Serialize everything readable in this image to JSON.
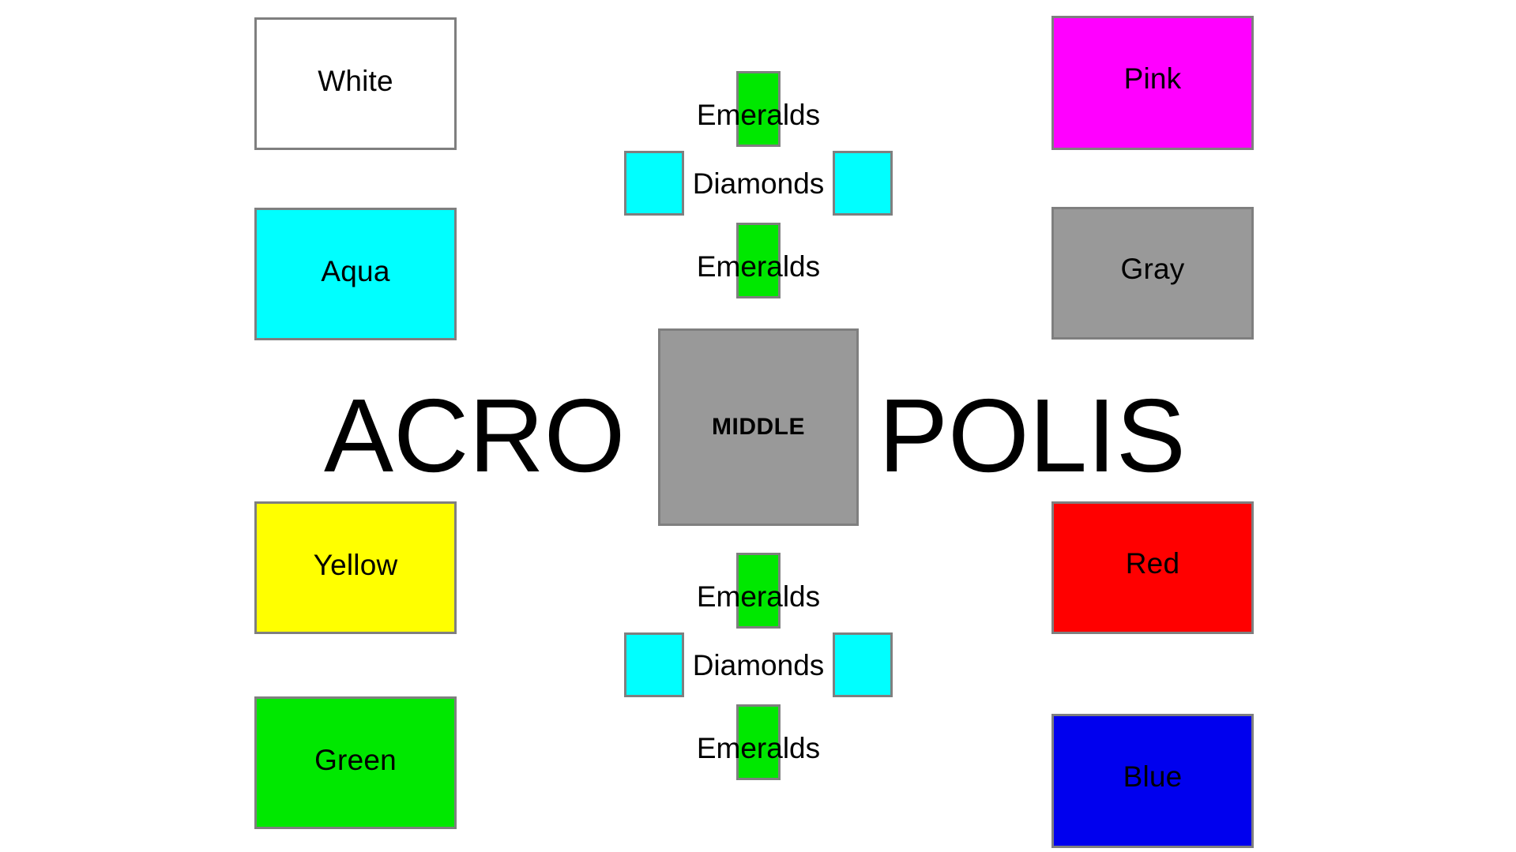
{
  "scene": {
    "background_color": "#ffffff",
    "border_color": "#7f7f7f"
  },
  "wordmark": {
    "left_text": "ACRO",
    "right_text": "POLIS",
    "full_text": "ACROPOLIS"
  },
  "middle": {
    "label": "MIDDLE",
    "fill_color": "#999999"
  },
  "left_column": [
    {
      "label": "White",
      "fill_color": "#ffffff"
    },
    {
      "label": "Aqua",
      "fill_color": "#00ffff"
    },
    {
      "label": "Yellow",
      "fill_color": "#ffff00"
    },
    {
      "label": "Green",
      "fill_color": "#00e800"
    }
  ],
  "right_column": [
    {
      "label": "Pink",
      "fill_color": "#ff00ff"
    },
    {
      "label": "Gray",
      "fill_color": "#999999"
    },
    {
      "label": "Red",
      "fill_color": "#ff0000"
    },
    {
      "label": "Blue",
      "fill_color": "#0000ee"
    }
  ],
  "clusters": [
    {
      "position": "top",
      "emerald_top_label": "Emeralds",
      "diamond_label": "Diamonds",
      "emerald_bottom_label": "Emeralds",
      "emerald_color": "#00e800",
      "diamond_color": "#00ffff"
    },
    {
      "position": "bottom",
      "emerald_top_label": "Emeralds",
      "diamond_label": "Diamonds",
      "emerald_bottom_label": "Emeralds",
      "emerald_color": "#00e800",
      "diamond_color": "#00ffff"
    }
  ]
}
